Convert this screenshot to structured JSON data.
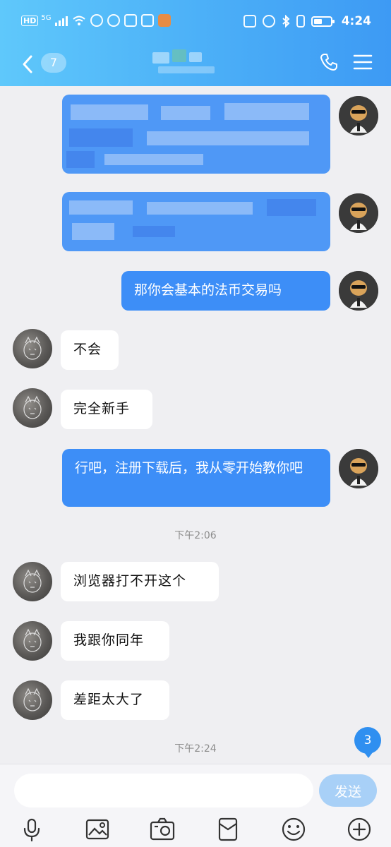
{
  "status_bar": {
    "left": {
      "hd": "HD",
      "network": "5G"
    },
    "time": "4:24"
  },
  "header": {
    "unread_count": "7"
  },
  "messages": [
    {
      "type": "blurred",
      "side": "out"
    },
    {
      "type": "blurred",
      "side": "out"
    },
    {
      "type": "text",
      "side": "out",
      "text": "那你会基本的法币交易吗"
    },
    {
      "type": "text",
      "side": "in",
      "text": "不会"
    },
    {
      "type": "text",
      "side": "in",
      "text": "完全新手"
    },
    {
      "type": "text",
      "side": "out",
      "text": "行吧，注册下载后，我从零开始教你吧"
    },
    {
      "type": "time",
      "text": "下午2:06"
    },
    {
      "type": "text",
      "side": "in",
      "text": "浏览器打不开这个"
    },
    {
      "type": "text",
      "side": "in",
      "text": "我跟你同年"
    },
    {
      "type": "text",
      "side": "in",
      "text": "差距太大了"
    },
    {
      "type": "time",
      "text": "下午2:24"
    }
  ],
  "new_message_badge": "3",
  "input": {
    "placeholder": "",
    "send_label": "发送"
  },
  "toolbar_icons": [
    "microphone-icon",
    "image-icon",
    "camera-icon",
    "red-packet-icon",
    "emoji-icon",
    "plus-icon"
  ],
  "colors": {
    "header_gradient_start": "#5fc8fb",
    "header_gradient_end": "#3d9af4",
    "outgoing_bubble": "#3d8ef7",
    "incoming_bubble": "#ffffff",
    "background": "#efeff2",
    "send_button": "#a8d0f7"
  }
}
